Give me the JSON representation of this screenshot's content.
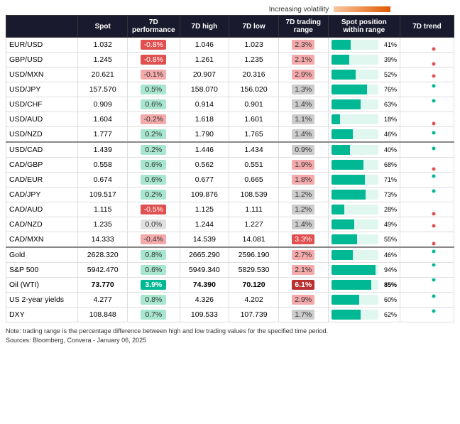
{
  "header": {
    "volatility_label": "Increasing volatility",
    "columns": [
      "",
      "Spot",
      "7D performance",
      "7D high",
      "7D low",
      "7D trading range",
      "Spot position within range",
      "7D trend"
    ]
  },
  "sections": [
    {
      "id": "forex1",
      "rows": [
        {
          "pair": "EUR/USD",
          "spot": "1.032",
          "perf": "-0.8%",
          "perf_type": "neg_dark",
          "high": "1.046",
          "low": "1.023",
          "range": "2.3%",
          "range_type": "neg_light",
          "bar_pct": 41,
          "trend_pct": "41%",
          "trend_type": "down"
        },
        {
          "pair": "GBP/USD",
          "spot": "1.245",
          "perf": "-0.8%",
          "perf_type": "neg_dark",
          "high": "1.261",
          "low": "1.235",
          "range": "2.1%",
          "range_type": "neg_light",
          "bar_pct": 39,
          "trend_pct": "39%",
          "trend_type": "down"
        },
        {
          "pair": "USD/MXN",
          "spot": "20.621",
          "perf": "-0.1%",
          "perf_type": "neg_light",
          "high": "20.907",
          "low": "20.316",
          "range": "2.9%",
          "range_type": "neg_light",
          "bar_pct": 52,
          "trend_pct": "52%",
          "trend_type": "down_slight"
        },
        {
          "pair": "USD/JPY",
          "spot": "157.570",
          "perf": "0.5%",
          "perf_type": "pos_light",
          "high": "158.070",
          "low": "156.020",
          "range": "1.3%",
          "range_type": "neutral",
          "bar_pct": 76,
          "trend_pct": "76%",
          "trend_type": "up"
        },
        {
          "pair": "USD/CHF",
          "spot": "0.909",
          "perf": "0.6%",
          "perf_type": "pos_light",
          "high": "0.914",
          "low": "0.901",
          "range": "1.4%",
          "range_type": "neutral",
          "bar_pct": 63,
          "trend_pct": "63%",
          "trend_type": "up"
        },
        {
          "pair": "USD/AUD",
          "spot": "1.604",
          "perf": "-0.2%",
          "perf_type": "neg_light",
          "high": "1.618",
          "low": "1.601",
          "range": "1.1%",
          "range_type": "neutral",
          "bar_pct": 18,
          "trend_pct": "18%",
          "trend_type": "down"
        },
        {
          "pair": "USD/NZD",
          "spot": "1.777",
          "perf": "0.2%",
          "perf_type": "pos_light",
          "high": "1.790",
          "low": "1.765",
          "range": "1.4%",
          "range_type": "neutral",
          "bar_pct": 46,
          "trend_pct": "46%",
          "trend_type": "up_slight"
        }
      ]
    },
    {
      "id": "forex2",
      "rows": [
        {
          "pair": "USD/CAD",
          "spot": "1.439",
          "perf": "0.2%",
          "perf_type": "pos_light",
          "high": "1.446",
          "low": "1.434",
          "range": "0.9%",
          "range_type": "neutral",
          "bar_pct": 40,
          "trend_pct": "40%",
          "trend_type": "up_slight"
        },
        {
          "pair": "CAD/GBP",
          "spot": "0.558",
          "perf": "0.6%",
          "perf_type": "pos_light",
          "high": "0.562",
          "low": "0.551",
          "range": "1.9%",
          "range_type": "neg_light",
          "bar_pct": 68,
          "trend_pct": "68%",
          "trend_type": "down"
        },
        {
          "pair": "CAD/EUR",
          "spot": "0.674",
          "perf": "0.6%",
          "perf_type": "pos_light",
          "high": "0.677",
          "low": "0.665",
          "range": "1.8%",
          "range_type": "neg_light",
          "bar_pct": 71,
          "trend_pct": "71%",
          "trend_type": "up"
        },
        {
          "pair": "CAD/JPY",
          "spot": "109.517",
          "perf": "0.2%",
          "perf_type": "pos_light",
          "high": "109.876",
          "low": "108.539",
          "range": "1.2%",
          "range_type": "neutral",
          "bar_pct": 73,
          "trend_pct": "73%",
          "trend_type": "up"
        },
        {
          "pair": "CAD/AUD",
          "spot": "1.115",
          "perf": "-0.5%",
          "perf_type": "neg_dark",
          "high": "1.125",
          "low": "1.111",
          "range": "1.2%",
          "range_type": "neutral",
          "bar_pct": 28,
          "trend_pct": "28%",
          "trend_type": "down"
        },
        {
          "pair": "CAD/NZD",
          "spot": "1.235",
          "perf": "0.0%",
          "perf_type": "neutral",
          "high": "1.244",
          "low": "1.227",
          "range": "1.4%",
          "range_type": "neutral",
          "bar_pct": 49,
          "trend_pct": "49%",
          "trend_type": "down_slight"
        },
        {
          "pair": "CAD/MXN",
          "spot": "14.333",
          "perf": "-0.4%",
          "perf_type": "neg_light",
          "high": "14.539",
          "low": "14.081",
          "range": "3.3%",
          "range_type": "neg_dark",
          "bar_pct": 55,
          "trend_pct": "55%",
          "trend_type": "down"
        }
      ]
    },
    {
      "id": "commodities",
      "rows": [
        {
          "pair": "Gold",
          "spot": "2628.320",
          "perf": "0.8%",
          "perf_type": "pos_light",
          "high": "2665.290",
          "low": "2596.190",
          "range": "2.7%",
          "range_type": "neg_light",
          "bar_pct": 46,
          "trend_pct": "46%",
          "trend_type": "up",
          "bold": false
        },
        {
          "pair": "S&P 500",
          "spot": "5942.470",
          "perf": "0.6%",
          "perf_type": "pos_light",
          "high": "5949.340",
          "low": "5829.530",
          "range": "2.1%",
          "range_type": "neg_light",
          "bar_pct": 94,
          "trend_pct": "94%",
          "trend_type": "up_strong",
          "bold": false
        },
        {
          "pair": "Oil (WTI)",
          "spot": "73.770",
          "perf": "3.9%",
          "perf_type": "pos_dark",
          "high": "74.390",
          "low": "70.120",
          "range": "6.1%",
          "range_type": "neg_darkest",
          "bar_pct": 85,
          "trend_pct": "85%",
          "trend_type": "up_strong",
          "bold": true
        },
        {
          "pair": "US 2-year yields",
          "spot": "4.277",
          "perf": "0.8%",
          "perf_type": "pos_light",
          "high": "4.326",
          "low": "4.202",
          "range": "2.9%",
          "range_type": "neg_light",
          "bar_pct": 60,
          "trend_pct": "60%",
          "trend_type": "up",
          "bold": false
        },
        {
          "pair": "DXY",
          "spot": "108.848",
          "perf": "0.7%",
          "perf_type": "pos_light",
          "high": "109.533",
          "low": "107.739",
          "range": "1.7%",
          "range_type": "neutral",
          "bar_pct": 62,
          "trend_pct": "62%",
          "trend_type": "up",
          "bold": false
        }
      ]
    }
  ],
  "footer": {
    "note": "Note: trading range is the percentage difference between high and low trading values for the specified time period.",
    "sources": "Sources: Bloomberg, Convera - January 06, 2025"
  }
}
